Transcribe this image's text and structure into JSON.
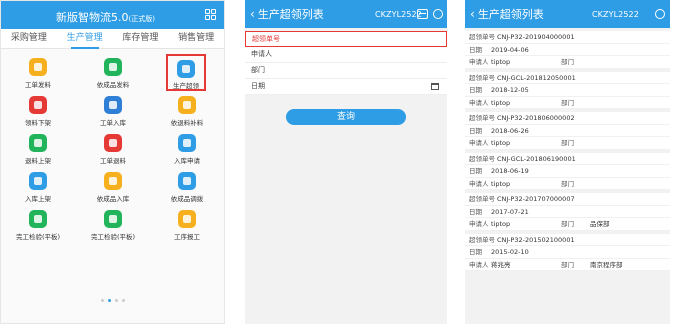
{
  "home": {
    "title": "新版智物流5.0",
    "title_badge": "(正式版)",
    "tabs": [
      {
        "label": "采购管理"
      },
      {
        "label": "生产管理"
      },
      {
        "label": "库存管理"
      },
      {
        "label": "销售管理"
      }
    ],
    "active_tab": 1,
    "modules": [
      {
        "label": "工单发料",
        "icon": "material-issue-icon",
        "color": "#f6b01e"
      },
      {
        "label": "依成品发料",
        "icon": "truck-issue-icon",
        "color": "#22b45a"
      },
      {
        "label": "生产超领",
        "icon": "over-requisition-icon",
        "color": "#2f9de5"
      },
      {
        "label": "领料下架",
        "icon": "unshelve-icon",
        "color": "#e53935"
      },
      {
        "label": "工单入库",
        "icon": "inbound-icon",
        "color": "#2f7fd6"
      },
      {
        "label": "依退料补料",
        "icon": "return-refill-icon",
        "color": "#f6b01e"
      },
      {
        "label": "退料上架",
        "icon": "return-shelve-icon",
        "color": "#22b45a"
      },
      {
        "label": "工单退料",
        "icon": "order-return-icon",
        "color": "#e53935"
      },
      {
        "label": "入库申请",
        "icon": "inbound-request-icon",
        "color": "#2f9de5"
      },
      {
        "label": "入库上架",
        "icon": "shelve-icon",
        "color": "#2f9de5"
      },
      {
        "label": "依成品入库",
        "icon": "product-inbound-icon",
        "color": "#f6b01e"
      },
      {
        "label": "依成品调拨",
        "icon": "transfer-icon",
        "color": "#2f9de5"
      },
      {
        "label": "完工检验(平板)",
        "icon": "inspection-icon",
        "color": "#22b45a"
      },
      {
        "label": "完工检验(平板)",
        "icon": "inspection-icon",
        "color": "#22b45a"
      },
      {
        "label": "工序报工",
        "icon": "process-report-icon",
        "color": "#f6b01e"
      }
    ],
    "page_dots": 4,
    "active_dot": 1
  },
  "search_screen": {
    "title": "生产超领列表",
    "code": "CKZYL2522",
    "fields": [
      {
        "label": "超领单号"
      },
      {
        "label": "申请人"
      },
      {
        "label": "部门"
      },
      {
        "label": "日期"
      }
    ],
    "query_button": "查询"
  },
  "list_screen": {
    "title": "生产超领列表",
    "code": "CKZYL2522",
    "labels": {
      "order_no": "超领单号",
      "date": "日期",
      "applicant": "申请人",
      "dept": "部门"
    },
    "records": [
      {
        "order_no": "CNJ-P32-201904000001",
        "date": "2019-04-06",
        "applicant": "tiptop",
        "dept": ""
      },
      {
        "order_no": "CNJ-GCL-201812050001",
        "date": "2018-12-05",
        "applicant": "tiptop",
        "dept": ""
      },
      {
        "order_no": "CNJ-P32-201806000002",
        "date": "2018-06-26",
        "applicant": "tiptop",
        "dept": ""
      },
      {
        "order_no": "CNJ-GCL-201806190001",
        "date": "2018-06-19",
        "applicant": "tiptop",
        "dept": ""
      },
      {
        "order_no": "CNJ-P32-201707000007",
        "date": "2017-07-21",
        "applicant": "tiptop",
        "dept": "品保部"
      },
      {
        "order_no": "CNJ-P32-201502100001",
        "date": "2015-02-10",
        "applicant": "蒋兆亮",
        "dept": "南京程序部"
      }
    ]
  }
}
